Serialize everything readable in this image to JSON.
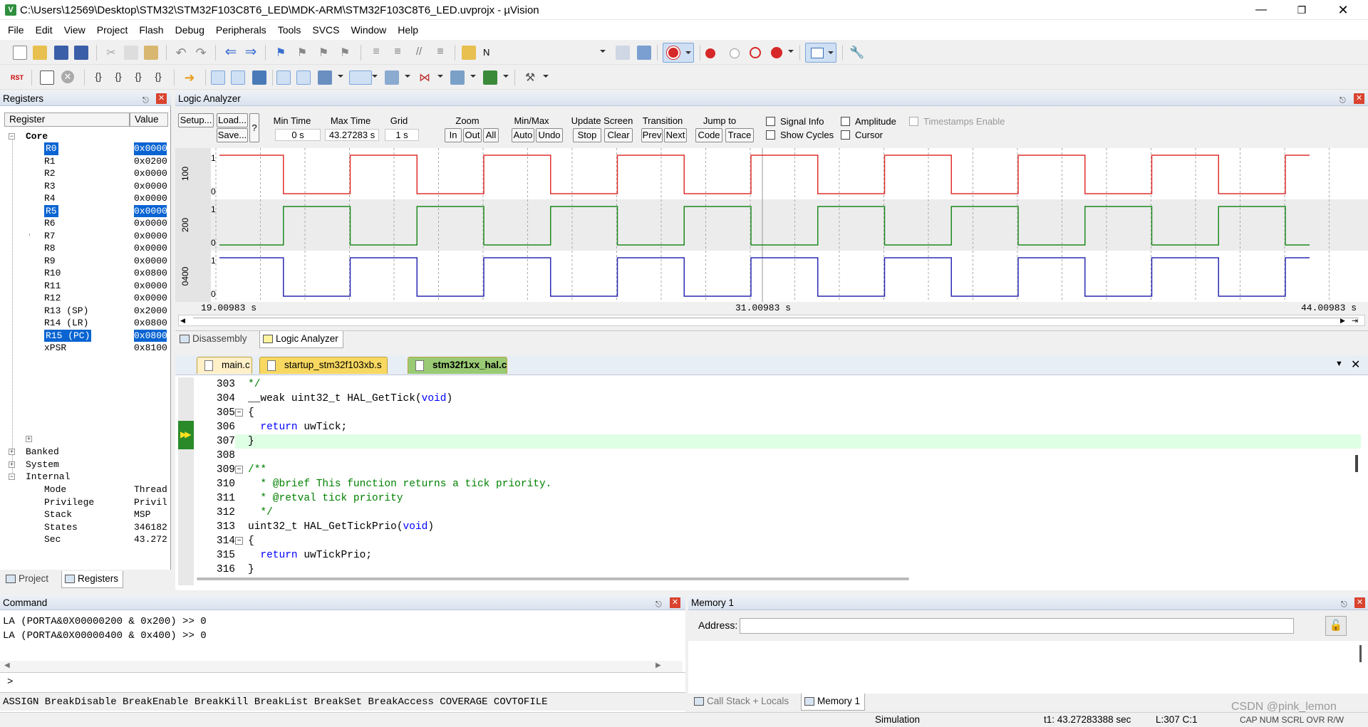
{
  "window": {
    "title": "C:\\Users\\12569\\Desktop\\STM32\\STM32F103C8T6_LED\\MDK-ARM\\STM32F103C8T6_LED.uvprojx - µVision"
  },
  "menu": [
    "File",
    "Edit",
    "View",
    "Project",
    "Flash",
    "Debug",
    "Peripherals",
    "Tools",
    "SVCS",
    "Window",
    "Help"
  ],
  "toolbar": {
    "find_text": "N"
  },
  "registers": {
    "title": "Registers",
    "col_register": "Register",
    "col_value": "Value",
    "core": "Core",
    "rows": [
      {
        "name": "R0",
        "value": "0x0000",
        "sel": true
      },
      {
        "name": "R1",
        "value": "0x0200",
        "sel": false
      },
      {
        "name": "R2",
        "value": "0x0000",
        "sel": false
      },
      {
        "name": "R3",
        "value": "0x0000",
        "sel": false
      },
      {
        "name": "R4",
        "value": "0x0000",
        "sel": false
      },
      {
        "name": "R5",
        "value": "0x0000",
        "sel": true
      },
      {
        "name": "R6",
        "value": "0x0000",
        "sel": false
      },
      {
        "name": "R7",
        "value": "0x0000",
        "sel": false
      },
      {
        "name": "R8",
        "value": "0x0000",
        "sel": false
      },
      {
        "name": "R9",
        "value": "0x0000",
        "sel": false
      },
      {
        "name": "R10",
        "value": "0x0800",
        "sel": false
      },
      {
        "name": "R11",
        "value": "0x0000",
        "sel": false
      },
      {
        "name": "R12",
        "value": "0x0000",
        "sel": false
      },
      {
        "name": "R13 (SP)",
        "value": "0x2000",
        "sel": false
      },
      {
        "name": "R14 (LR)",
        "value": "0x0800",
        "sel": false
      },
      {
        "name": "R15 (PC)",
        "value": "0x0800",
        "sel": true
      },
      {
        "name": "xPSR",
        "value": "0x8100",
        "sel": false
      }
    ],
    "groups": [
      "Banked",
      "System",
      "Internal"
    ],
    "internal": [
      {
        "name": "Mode",
        "value": "Thread"
      },
      {
        "name": "Privilege",
        "value": "Privil"
      },
      {
        "name": "Stack",
        "value": "MSP"
      },
      {
        "name": "States",
        "value": "346182"
      },
      {
        "name": "Sec",
        "value": "43.272"
      }
    ],
    "tabs": {
      "project": "Project",
      "registers": "Registers"
    }
  },
  "logic_analyzer": {
    "title": "Logic Analyzer",
    "setup": "Setup...",
    "load": "Load...",
    "save": "Save...",
    "help": "?",
    "min_time_label": "Min Time",
    "min_time": "0 s",
    "max_time_label": "Max Time",
    "max_time": "43.27283 s",
    "grid_label": "Grid",
    "grid": "1 s",
    "zoom_label": "Zoom",
    "zoom_in": "In",
    "zoom_out": "Out",
    "zoom_all": "All",
    "minmax_label": "Min/Max",
    "auto": "Auto",
    "undo": "Undo",
    "update_label": "Update Screen",
    "stop": "Stop",
    "clear": "Clear",
    "transition_label": "Transition",
    "prev": "Prev",
    "next": "Next",
    "jump_label": "Jump to",
    "code": "Code",
    "trace": "Trace",
    "signal_info": "Signal Info",
    "show_cycles": "Show Cycles",
    "amplitude": "Amplitude",
    "cursor": "Cursor",
    "timestamps": "Timestamps Enable",
    "signals": [
      {
        "label": "100",
        "color": "#e0302e"
      },
      {
        "label": "200",
        "color": "#1e8a1e"
      },
      {
        "label": "0400",
        "color": "#2a2ab4"
      }
    ],
    "time_left": "19.00983 s",
    "time_mid": "31.00983 s",
    "time_right": "44.00983 s"
  },
  "view_tabs": {
    "disassembly": "Disassembly",
    "logic": "Logic Analyzer"
  },
  "editor": {
    "tabs": [
      "main.c",
      "startup_stm32f103xb.s",
      "stm32f1xx_hal.c"
    ],
    "lines": [
      {
        "n": "303",
        "t": "*/",
        "c": "cm"
      },
      {
        "n": "304",
        "t": "__weak uint32_t HAL_GetTick(void)",
        "c": "kwv"
      },
      {
        "n": "305",
        "t": "{",
        "c": ""
      },
      {
        "n": "306",
        "t": "  return uwTick;",
        "c": "kwr"
      },
      {
        "n": "307",
        "t": "}",
        "c": ""
      },
      {
        "n": "308",
        "t": "",
        "c": ""
      },
      {
        "n": "309",
        "t": "/**",
        "c": "cm"
      },
      {
        "n": "310",
        "t": "  * @brief This function returns a tick priority.",
        "c": "cm"
      },
      {
        "n": "311",
        "t": "  * @retval tick priority",
        "c": "cm"
      },
      {
        "n": "312",
        "t": "  */",
        "c": "cm"
      },
      {
        "n": "313",
        "t": "uint32_t HAL_GetTickPrio(void)",
        "c": "kwv"
      },
      {
        "n": "314",
        "t": "{",
        "c": ""
      },
      {
        "n": "315",
        "t": "  return uwTickPrio;",
        "c": "kwr"
      },
      {
        "n": "316",
        "t": "}",
        "c": ""
      }
    ]
  },
  "command": {
    "title": "Command",
    "lines": [
      "LA (PORTA&0X00000200 & 0x200) >> 0",
      "LA (PORTA&0X00000400 & 0x400) >> 0"
    ],
    "prompt": ">",
    "hints": "ASSIGN BreakDisable BreakEnable BreakKill BreakList BreakSet BreakAccess COVERAGE COVTOFILE"
  },
  "memory": {
    "title": "Memory 1",
    "address_label": "Address:",
    "tab_callstack": "Call Stack + Locals",
    "tab_memory": "Memory 1"
  },
  "status": {
    "mode": "Simulation",
    "t1": "t1: 43.27283388 sec",
    "pos": "L:307 C:1",
    "flags": "CAP  NUM  SCRL  OVR  R/W",
    "watermark": "CSDN @pink_lemon"
  }
}
